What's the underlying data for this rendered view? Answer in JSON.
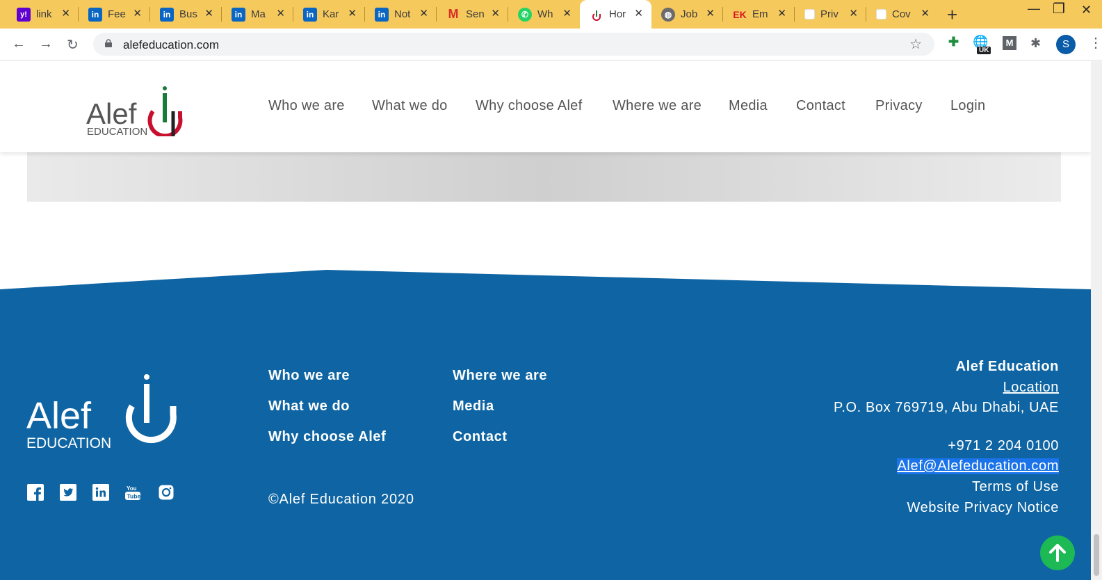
{
  "browser": {
    "tabs": [
      {
        "title": "link",
        "icon": "yahoo-icon"
      },
      {
        "title": "Fee",
        "icon": "linkedin-icon"
      },
      {
        "title": "Bus",
        "icon": "linkedin-icon"
      },
      {
        "title": "Ma",
        "icon": "linkedin-icon"
      },
      {
        "title": "Kar",
        "icon": "linkedin-icon"
      },
      {
        "title": "Not",
        "icon": "linkedin-icon"
      },
      {
        "title": "Sen",
        "icon": "gmail-icon"
      },
      {
        "title": "Wh",
        "icon": "whatsapp-icon"
      },
      {
        "title": "Hor",
        "icon": "alef-icon"
      },
      {
        "title": "Job",
        "icon": "globe-icon"
      },
      {
        "title": "Em",
        "icon": "ek-icon"
      },
      {
        "title": "Priv",
        "icon": "blank-page-icon"
      },
      {
        "title": "Cov",
        "icon": "blank-page-icon"
      }
    ],
    "active_tab": 8,
    "url": "alefeducation.com",
    "profile_initial": "S",
    "ext_badge": "UK"
  },
  "header": {
    "logo_word": "Alef",
    "logo_sub": "EDUCATION",
    "nav": [
      "Who we are",
      "What we do",
      "Why choose Alef",
      "Where we are",
      "Media",
      "Contact",
      "Privacy",
      "Login"
    ]
  },
  "footer": {
    "logo_word": "Alef",
    "logo_sub": "EDUCATION",
    "col1": [
      "Who we are",
      "What we do",
      "Why choose Alef"
    ],
    "col2": [
      "Where we are",
      "Media",
      "Contact"
    ],
    "copyright": "©Alef Education 2020",
    "company": "Alef Education",
    "location_link": "Location",
    "address": "P.O. Box 769719, Abu Dhabi, UAE",
    "phone": "+971 2 204 0100",
    "email": "Alef@Alefeducation.com",
    "terms": "Terms of Use",
    "privacy_notice": "Website Privacy Notice",
    "social": [
      "facebook-icon",
      "twitter-icon",
      "linkedin-icon",
      "youtube-icon",
      "instagram-icon"
    ]
  },
  "colors": {
    "tabstrip": "#f6c95d",
    "footer_blue": "#0f65a3",
    "brand_red": "#c8102e",
    "brand_green": "#1a7a3a",
    "to_top_green": "#1db954"
  }
}
